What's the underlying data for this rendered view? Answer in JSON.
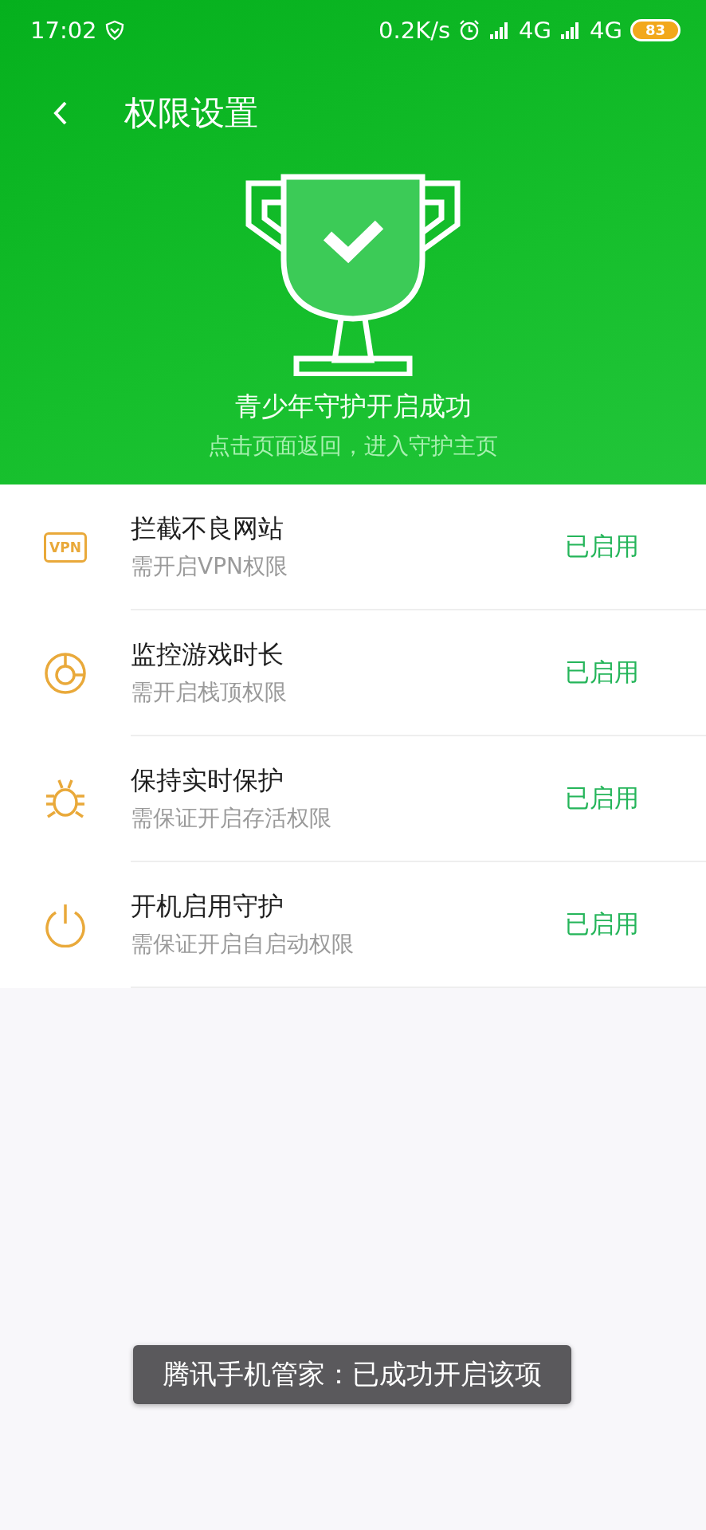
{
  "status_bar": {
    "time": "17:02",
    "net_speed": "0.2K/s",
    "signals": [
      "4G",
      "4G"
    ],
    "battery": "83"
  },
  "header": {
    "title": "权限设置",
    "result_title": "青少年守护开启成功",
    "result_hint": "点击页面返回，进入守护主页"
  },
  "permissions": [
    {
      "kind": "vpn",
      "icon_text": "VPN",
      "title": "拦截不良网站",
      "subtitle": "需开启VPN权限",
      "status": "已启用"
    },
    {
      "kind": "gauge",
      "title": "监控游戏时长",
      "subtitle": "需开启栈顶权限",
      "status": "已启用"
    },
    {
      "kind": "bug",
      "title": "保持实时保护",
      "subtitle": "需保证开启存活权限",
      "status": "已启用"
    },
    {
      "kind": "power",
      "title": "开机启用守护",
      "subtitle": "需保证开启自启动权限",
      "status": "已启用"
    }
  ],
  "toast": "腾讯手机管家：已成功开启该项"
}
